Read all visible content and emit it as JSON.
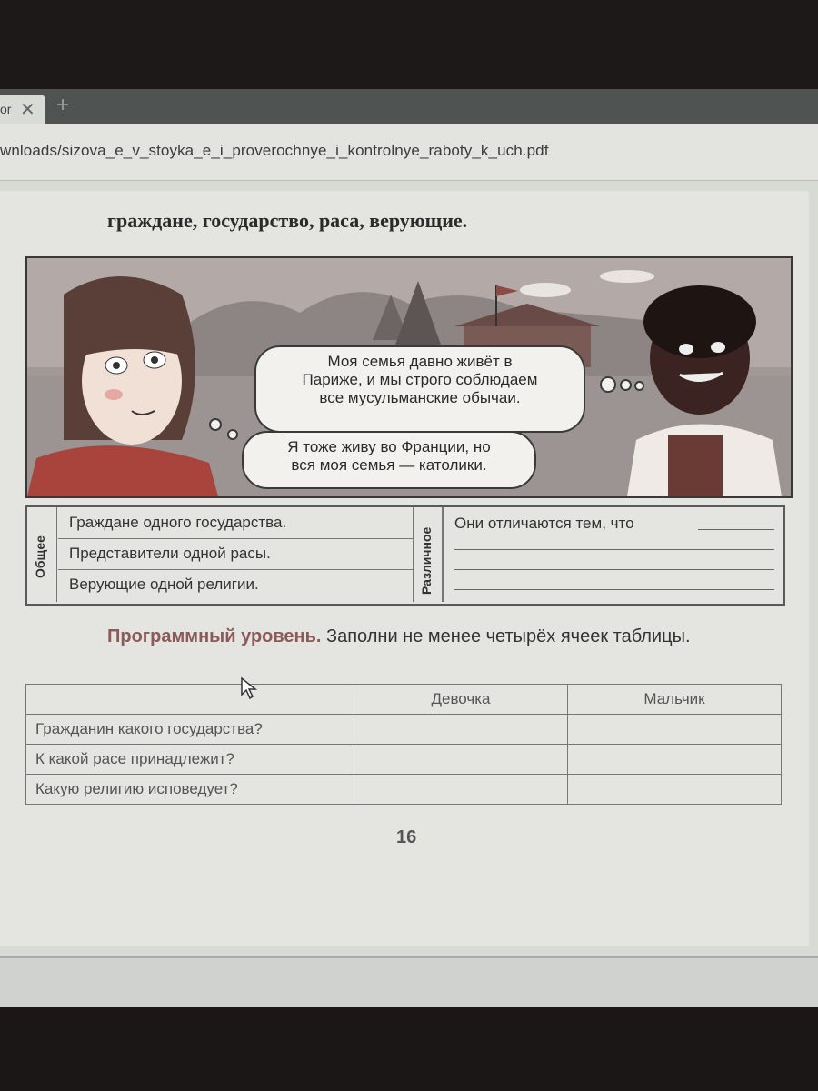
{
  "browser": {
    "tab_title": "or",
    "tab_close": "✕",
    "new_tab": "+",
    "url": "wnloads/sizova_e_v_stoyka_e_i_proverochnye_i_kontrolnye_raboty_k_uch.pdf"
  },
  "page": {
    "heading": "граждане, государство, раса, верующие.",
    "bubble_1": "Моя семья давно живёт в\nПариже, и мы строго соблюдаем\nвсе мусульманские обычаи.",
    "bubble_2": "Я тоже живу во Франции, но\nвся моя семья — католики.",
    "common_label": "Общее",
    "common_items": [
      "Граждане одного государства.",
      "Представители одной расы.",
      "Верующие одной религии."
    ],
    "diff_label": "Различное",
    "diff_text": "Они отличаются тем, что",
    "task_level": "Программный уровень.",
    "task_text": " Заполни не менее четырёх ячеек таблицы.",
    "table": {
      "headers": [
        "",
        "Девочка",
        "Мальчик"
      ],
      "rows": [
        "Гражданин какого государства?",
        "К какой расе принадлежит?",
        "Какую религию исповедует?"
      ]
    },
    "page_number": "16"
  }
}
